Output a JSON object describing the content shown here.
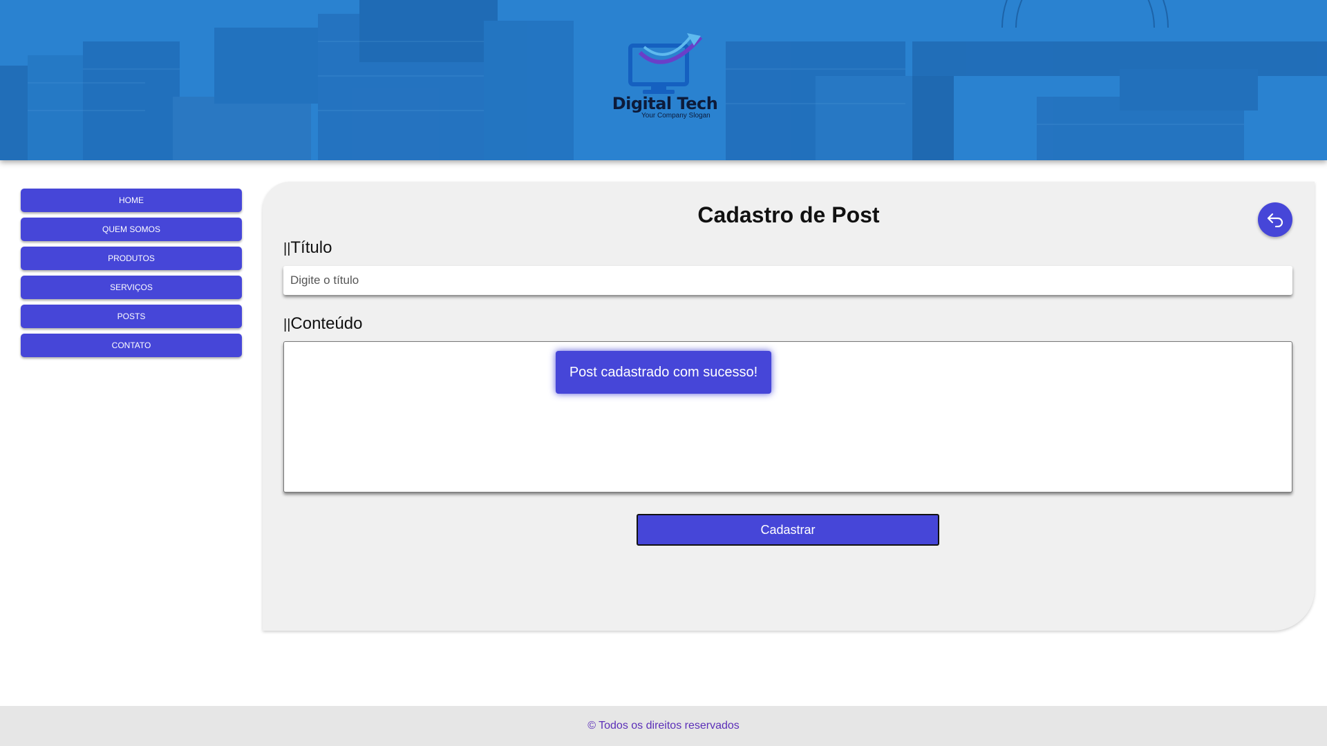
{
  "header": {
    "logo_title": "Digital Tech",
    "logo_slogan": "Your Company Slogan"
  },
  "sidebar": {
    "items": [
      {
        "label": "HOME"
      },
      {
        "label": "QUEM SOMOS"
      },
      {
        "label": "PRODUTOS"
      },
      {
        "label": "SERVIÇOS"
      },
      {
        "label": "POSTS"
      },
      {
        "label": "CONTATO"
      }
    ]
  },
  "main": {
    "title": "Cadastro de Post",
    "title_field": {
      "label": "Título",
      "placeholder": "Digite o título",
      "value": ""
    },
    "content_field": {
      "label": "Conteúdo",
      "value": ""
    },
    "toast": "Post cadastrado com sucesso!",
    "submit_label": "Cadastrar",
    "back_icon": "return-arrow-icon"
  },
  "footer": {
    "text": "© Todos os direitos reservados"
  },
  "colors": {
    "accent": "#4646d8",
    "banner_blue": "#1f74c2",
    "panel_bg": "#f0f0f0",
    "footer_bg": "#e6e6e6",
    "footer_text": "#5b2fb8"
  }
}
